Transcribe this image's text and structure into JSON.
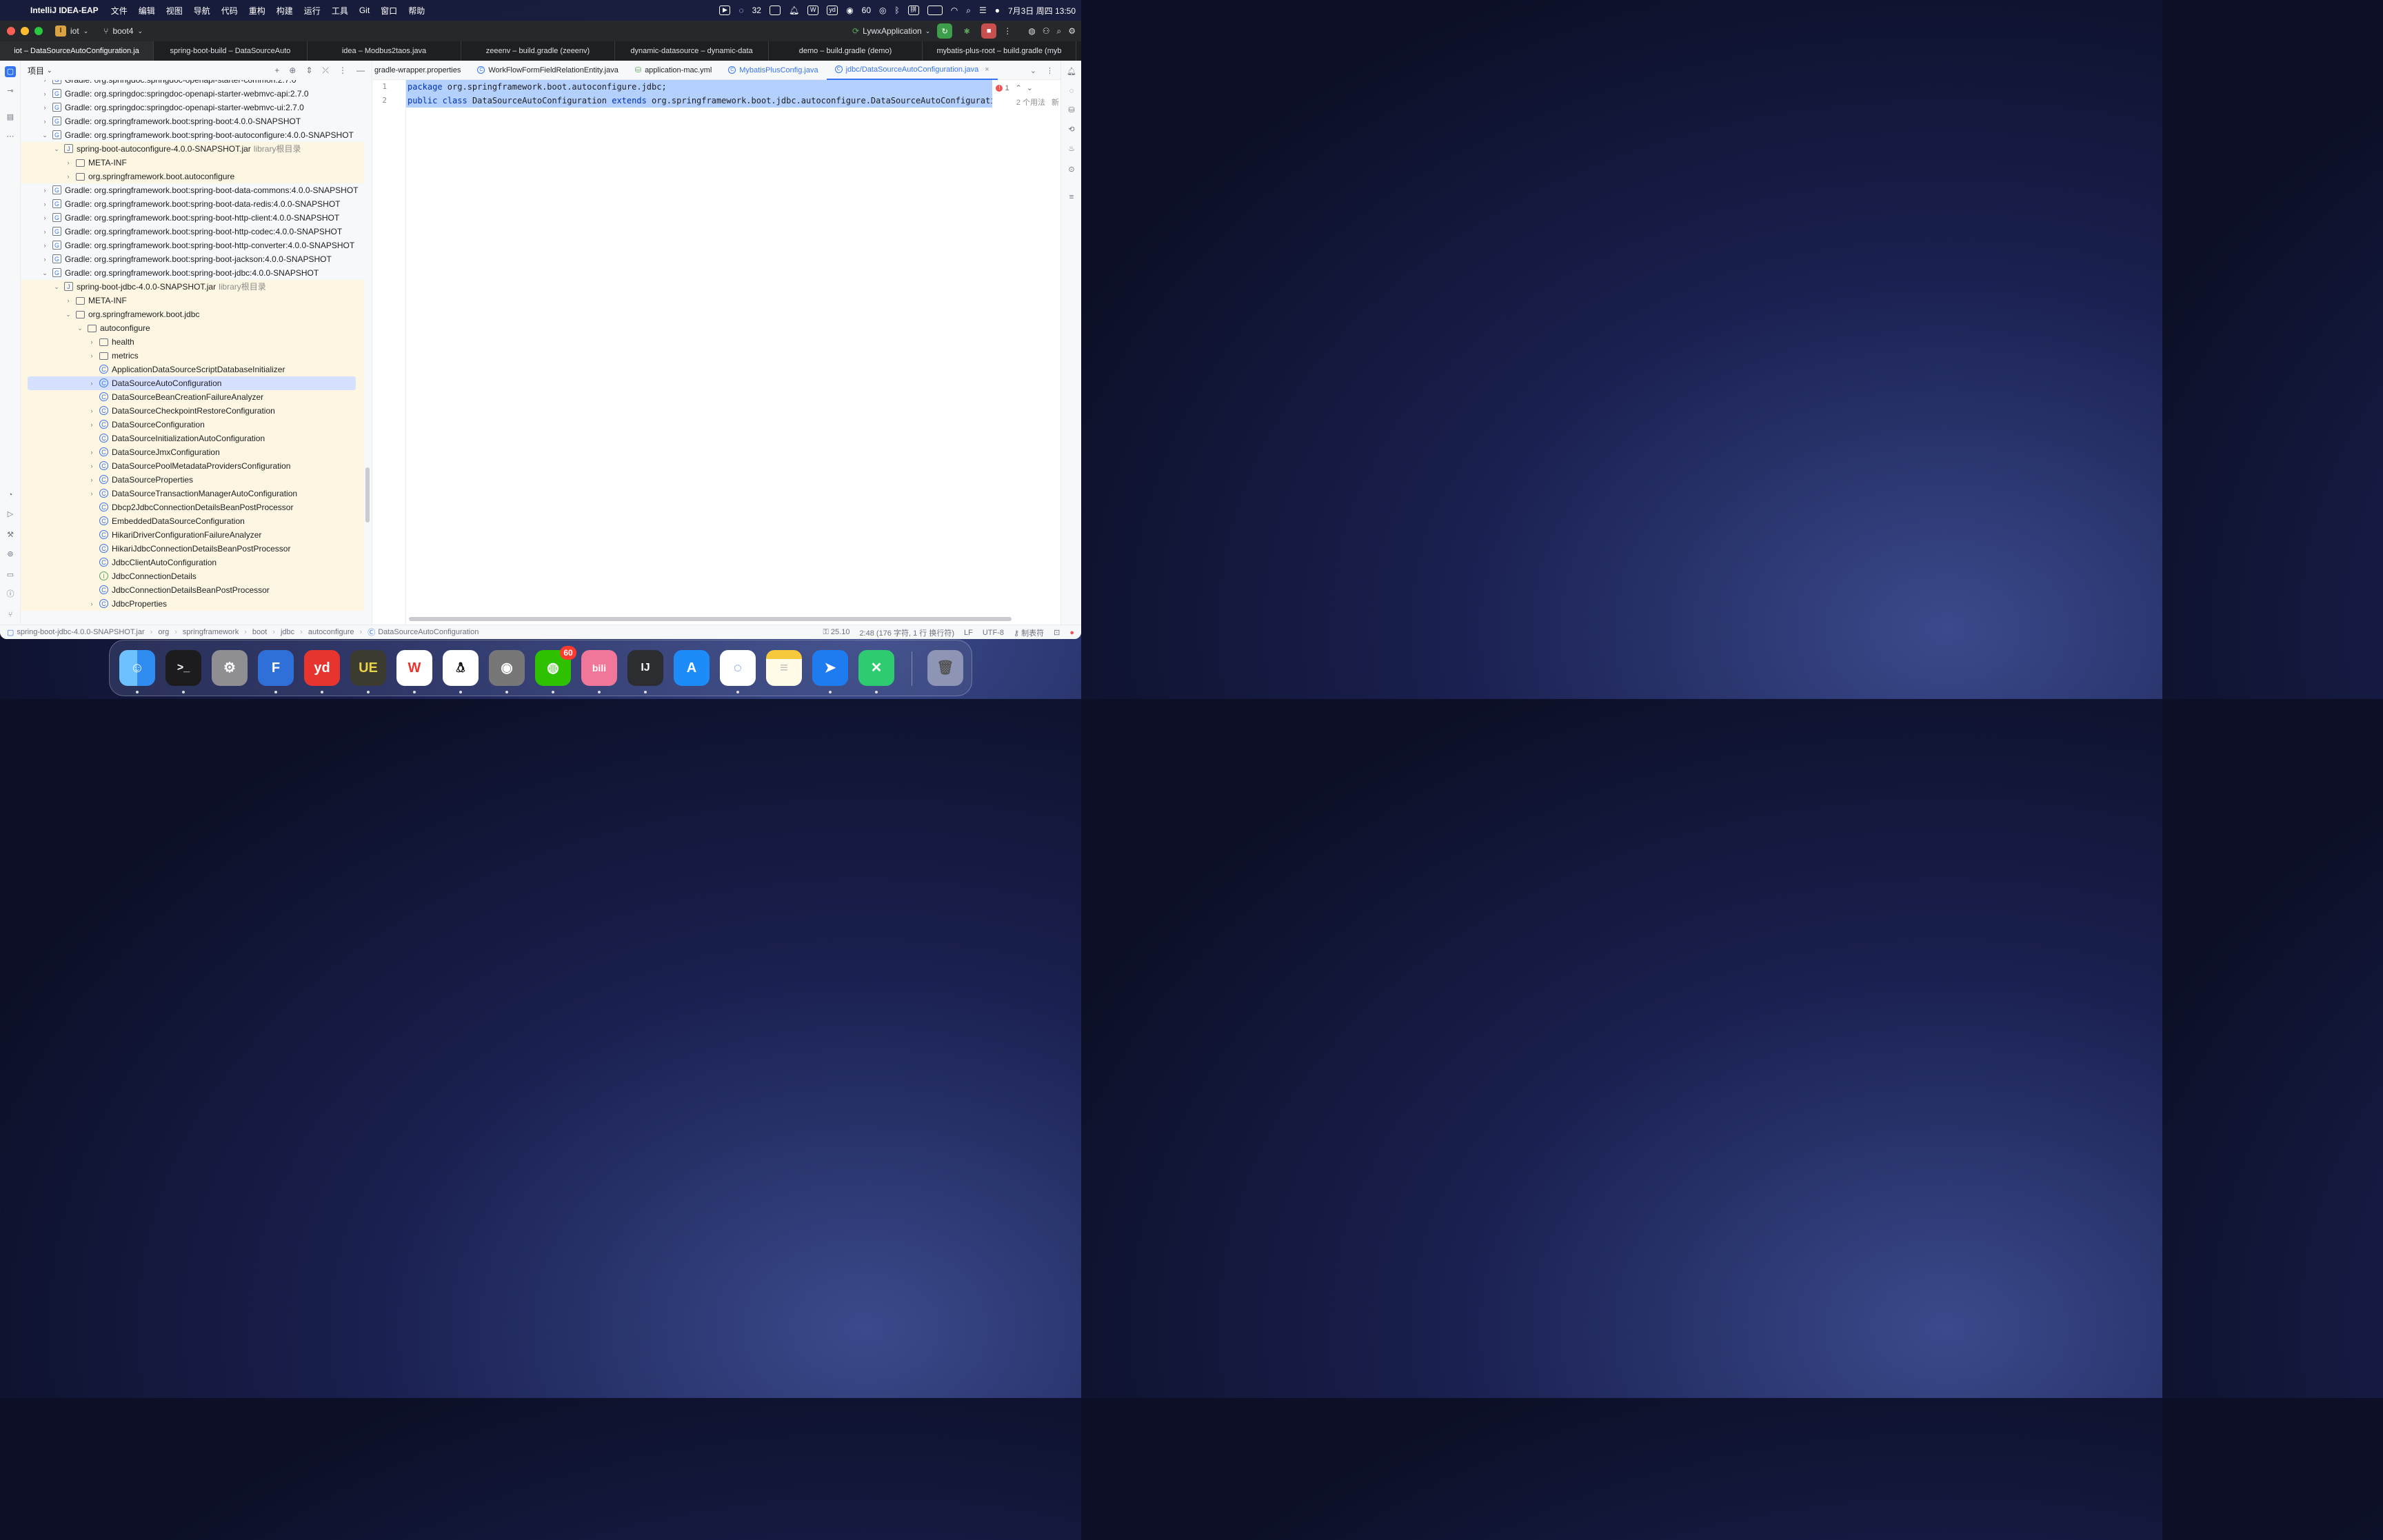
{
  "menubar": {
    "app": "IntelliJ IDEA-EAP",
    "items": [
      "文件",
      "编辑",
      "视图",
      "导航",
      "代码",
      "重构",
      "构建",
      "运行",
      "工具",
      "Git",
      "窗口",
      "帮助"
    ],
    "status_count_a": "32",
    "status_count_b": "60",
    "input_method": "拼",
    "datetime": "7月3日 周四 13:50"
  },
  "titlebar": {
    "project": "iot",
    "project_badge": "I",
    "branch": "boot4",
    "run_config": "LywxApplication"
  },
  "project_tabs": [
    "iot – DataSourceAutoConfiguration.ja",
    "spring-boot-build – DataSourceAuto",
    "idea – Modbus2taos.java",
    "zeeenv – build.gradle (zeeenv)",
    "dynamic-datasource – dynamic-data",
    "demo – build.gradle (demo)",
    "mybatis-plus-root – build.gradle (myb"
  ],
  "project_panel": {
    "title": "项目"
  },
  "tree": [
    {
      "label": "Gradle: org.springdoc:springdoc-openapi-starter-common:2.7.0",
      "icon": "gradle",
      "chev": "right",
      "level": 0,
      "hl": false
    },
    {
      "label": "Gradle: org.springdoc:springdoc-openapi-starter-webmvc-api:2.7.0",
      "icon": "gradle",
      "chev": "right",
      "level": 0,
      "hl": false
    },
    {
      "label": "Gradle: org.springdoc:springdoc-openapi-starter-webmvc-ui:2.7.0",
      "icon": "gradle",
      "chev": "right",
      "level": 0,
      "hl": false
    },
    {
      "label": "Gradle: org.springframework.boot:spring-boot:4.0.0-SNAPSHOT",
      "icon": "gradle",
      "chev": "right",
      "level": 0,
      "hl": false
    },
    {
      "label": "Gradle: org.springframework.boot:spring-boot-autoconfigure:4.0.0-SNAPSHOT",
      "icon": "gradle",
      "chev": "down",
      "level": 0,
      "hl": false
    },
    {
      "label": "spring-boot-autoconfigure-4.0.0-SNAPSHOT.jar",
      "sub": "library根目录",
      "icon": "jar",
      "chev": "down",
      "level": 1,
      "hl": true
    },
    {
      "label": "META-INF",
      "icon": "folder",
      "chev": "right",
      "level": 2,
      "hl": true
    },
    {
      "label": "org.springframework.boot.autoconfigure",
      "icon": "folder",
      "chev": "right",
      "level": 2,
      "hl": true
    },
    {
      "label": "Gradle: org.springframework.boot:spring-boot-data-commons:4.0.0-SNAPSHOT",
      "icon": "gradle",
      "chev": "right",
      "level": 0,
      "hl": false
    },
    {
      "label": "Gradle: org.springframework.boot:spring-boot-data-redis:4.0.0-SNAPSHOT",
      "icon": "gradle",
      "chev": "right",
      "level": 0,
      "hl": false
    },
    {
      "label": "Gradle: org.springframework.boot:spring-boot-http-client:4.0.0-SNAPSHOT",
      "icon": "gradle",
      "chev": "right",
      "level": 0,
      "hl": false
    },
    {
      "label": "Gradle: org.springframework.boot:spring-boot-http-codec:4.0.0-SNAPSHOT",
      "icon": "gradle",
      "chev": "right",
      "level": 0,
      "hl": false
    },
    {
      "label": "Gradle: org.springframework.boot:spring-boot-http-converter:4.0.0-SNAPSHOT",
      "icon": "gradle",
      "chev": "right",
      "level": 0,
      "hl": false
    },
    {
      "label": "Gradle: org.springframework.boot:spring-boot-jackson:4.0.0-SNAPSHOT",
      "icon": "gradle",
      "chev": "right",
      "level": 0,
      "hl": false
    },
    {
      "label": "Gradle: org.springframework.boot:spring-boot-jdbc:4.0.0-SNAPSHOT",
      "icon": "gradle",
      "chev": "down",
      "level": 0,
      "hl": false
    },
    {
      "label": "spring-boot-jdbc-4.0.0-SNAPSHOT.jar",
      "sub": "library根目录",
      "icon": "jar",
      "chev": "down",
      "level": 1,
      "hl": true
    },
    {
      "label": "META-INF",
      "icon": "folder",
      "chev": "right",
      "level": 2,
      "hl": true
    },
    {
      "label": "org.springframework.boot.jdbc",
      "icon": "folder",
      "chev": "down",
      "level": 2,
      "hl": true
    },
    {
      "label": "autoconfigure",
      "icon": "folder",
      "chev": "down",
      "level": 3,
      "hl": true
    },
    {
      "label": "health",
      "icon": "folder",
      "chev": "right",
      "level": 4,
      "hl": true
    },
    {
      "label": "metrics",
      "icon": "folder",
      "chev": "right",
      "level": 4,
      "hl": true
    },
    {
      "label": "ApplicationDataSourceScriptDatabaseInitializer",
      "icon": "cls",
      "chev": "",
      "level": 4,
      "hl": true
    },
    {
      "label": "DataSourceAutoConfiguration",
      "icon": "cls",
      "chev": "right",
      "level": 4,
      "hl": true,
      "selected": true
    },
    {
      "label": "DataSourceBeanCreationFailureAnalyzer",
      "icon": "cls",
      "chev": "",
      "level": 4,
      "hl": true
    },
    {
      "label": "DataSourceCheckpointRestoreConfiguration",
      "icon": "cls",
      "chev": "right",
      "level": 4,
      "hl": true
    },
    {
      "label": "DataSourceConfiguration",
      "icon": "cls",
      "chev": "right",
      "level": 4,
      "hl": true
    },
    {
      "label": "DataSourceInitializationAutoConfiguration",
      "icon": "cls",
      "chev": "",
      "level": 4,
      "hl": true
    },
    {
      "label": "DataSourceJmxConfiguration",
      "icon": "cls",
      "chev": "right",
      "level": 4,
      "hl": true
    },
    {
      "label": "DataSourcePoolMetadataProvidersConfiguration",
      "icon": "cls",
      "chev": "right",
      "level": 4,
      "hl": true
    },
    {
      "label": "DataSourceProperties",
      "icon": "cls",
      "chev": "right",
      "level": 4,
      "hl": true
    },
    {
      "label": "DataSourceTransactionManagerAutoConfiguration",
      "icon": "cls",
      "chev": "right",
      "level": 4,
      "hl": true
    },
    {
      "label": "Dbcp2JdbcConnectionDetailsBeanPostProcessor",
      "icon": "cls",
      "chev": "",
      "level": 4,
      "hl": true
    },
    {
      "label": "EmbeddedDataSourceConfiguration",
      "icon": "cls",
      "chev": "",
      "level": 4,
      "hl": true
    },
    {
      "label": "HikariDriverConfigurationFailureAnalyzer",
      "icon": "cls",
      "chev": "",
      "level": 4,
      "hl": true
    },
    {
      "label": "HikariJdbcConnectionDetailsBeanPostProcessor",
      "icon": "cls",
      "chev": "",
      "level": 4,
      "hl": true
    },
    {
      "label": "JdbcClientAutoConfiguration",
      "icon": "cls",
      "chev": "",
      "level": 4,
      "hl": true
    },
    {
      "label": "JdbcConnectionDetails",
      "icon": "intf",
      "chev": "",
      "level": 4,
      "hl": true
    },
    {
      "label": "JdbcConnectionDetailsBeanPostProcessor",
      "icon": "cls",
      "chev": "",
      "level": 4,
      "hl": true
    },
    {
      "label": "JdbcProperties",
      "icon": "cls",
      "chev": "right",
      "level": 4,
      "hl": true
    }
  ],
  "editor_tabs": [
    {
      "label": "gradle-wrapper.properties",
      "icon": "none",
      "active": false
    },
    {
      "label": "WorkFlowFormFieldRelationEntity.java",
      "icon": "class",
      "active": false
    },
    {
      "label": "application-mac.yml",
      "icon": "yml",
      "active": false
    },
    {
      "label": "MybatisPlusConfig.java",
      "icon": "class",
      "active": false
    },
    {
      "label": "jdbc/DataSourceAutoConfiguration.java",
      "icon": "class",
      "active": true
    }
  ],
  "editor": {
    "line_numbers": [
      "1",
      "2"
    ],
    "line1": {
      "kw": "package",
      "rest": " org.springframework.boot.autoconfigure.jdbc;"
    },
    "line2": {
      "kw1": "public",
      "kw2": "class",
      "name": " DataSourceAutoConfiguration ",
      "kw3": "extends",
      "rest": " org.springframework.boot.jdbc.autoconfigure.DataSourceAutoConfiguration {}"
    },
    "error_count": "1",
    "usages": "2 个用法",
    "inlay_new": "新"
  },
  "statusbar": {
    "breadcrumbs": [
      "spring-boot-jdbc-4.0.0-SNAPSHOT.jar",
      "org",
      "springframework",
      "boot",
      "jdbc",
      "autoconfigure",
      "DataSourceAutoConfiguration"
    ],
    "version": "25.10",
    "position": "2:48 (176 字符, 1 行 换行符)",
    "line_sep": "LF",
    "encoding": "UTF-8",
    "indent": "制表符"
  },
  "dock": {
    "wechat_badge": "60"
  },
  "colors": {
    "accent": "#3574f0",
    "selection": "#d5e1ff",
    "library_highlight": "#fdf6e3",
    "code_selection": "#b3d0ff"
  }
}
